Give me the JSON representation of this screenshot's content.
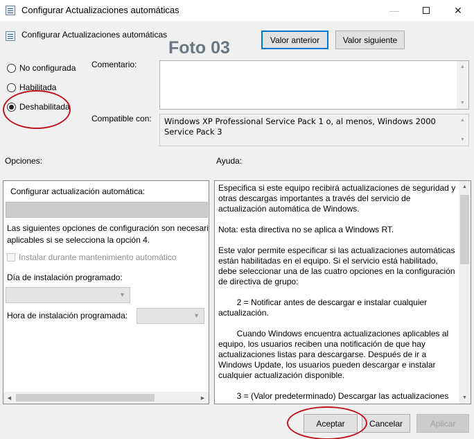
{
  "window": {
    "title": "Configurar Actualizaciones automáticas",
    "minimize_glyph": "—",
    "close_glyph": "✕"
  },
  "header": {
    "title": "Configurar Actualizaciones automáticas",
    "prev_button": "Valor anterior",
    "next_button": "Valor siguiente"
  },
  "watermark": "Foto 03",
  "state_options": [
    {
      "label": "No configurada",
      "selected": false
    },
    {
      "label": "Habilitada",
      "selected": false
    },
    {
      "label": "Deshabilitada",
      "selected": true
    }
  ],
  "comment": {
    "label": "Comentario:",
    "value": ""
  },
  "compatible": {
    "label": "Compatible con:",
    "value": "Windows XP Professional Service Pack 1 o, al menos, Windows 2000 Service Pack 3"
  },
  "options": {
    "label": "Opciones:",
    "configure_label": "Configurar actualización automática:",
    "configure_value": "",
    "info_text_line1": "Las siguientes opciones de configuración son necesaria",
    "info_text_line2": "aplicables si se selecciona la opción 4.",
    "maintenance_checkbox": "Instalar durante mantenimiento automático",
    "day_label": "Día de instalación programado:",
    "day_value": "",
    "hour_label": "Hora de instalación programada:",
    "hour_value": ""
  },
  "help": {
    "label": "Ayuda:",
    "paragraphs": [
      "Especifica si este equipo recibirá actualizaciones de seguridad y otras descargas importantes a través del servicio de actualización automática de Windows.",
      "Nota: esta directiva no se aplica a Windows RT.",
      "Este valor permite especificar si las actualizaciones automáticas están habilitadas en el equipo. Si el servicio está habilitado, debe seleccionar una de las cuatro opciones en la configuración de directiva de grupo:",
      "        2 = Notificar antes de descargar e instalar cualquier actualización.",
      "        Cuando Windows encuentra actualizaciones aplicables al equipo, los usuarios reciben una notificación de que hay actualizaciones listas para descargarse. Después de ir a Windows Update, los usuarios pueden descargar e instalar cualquier actualización disponible.",
      "        3 = (Valor predeterminado) Descargar las actualizaciones"
    ]
  },
  "footer": {
    "ok_button": "Aceptar",
    "cancel_button": "Cancelar",
    "apply_button": "Aplicar"
  },
  "colors": {
    "annotation": "#c0141c",
    "focus_border": "#0078d7",
    "dialog_bg": "#f0f0f0"
  }
}
